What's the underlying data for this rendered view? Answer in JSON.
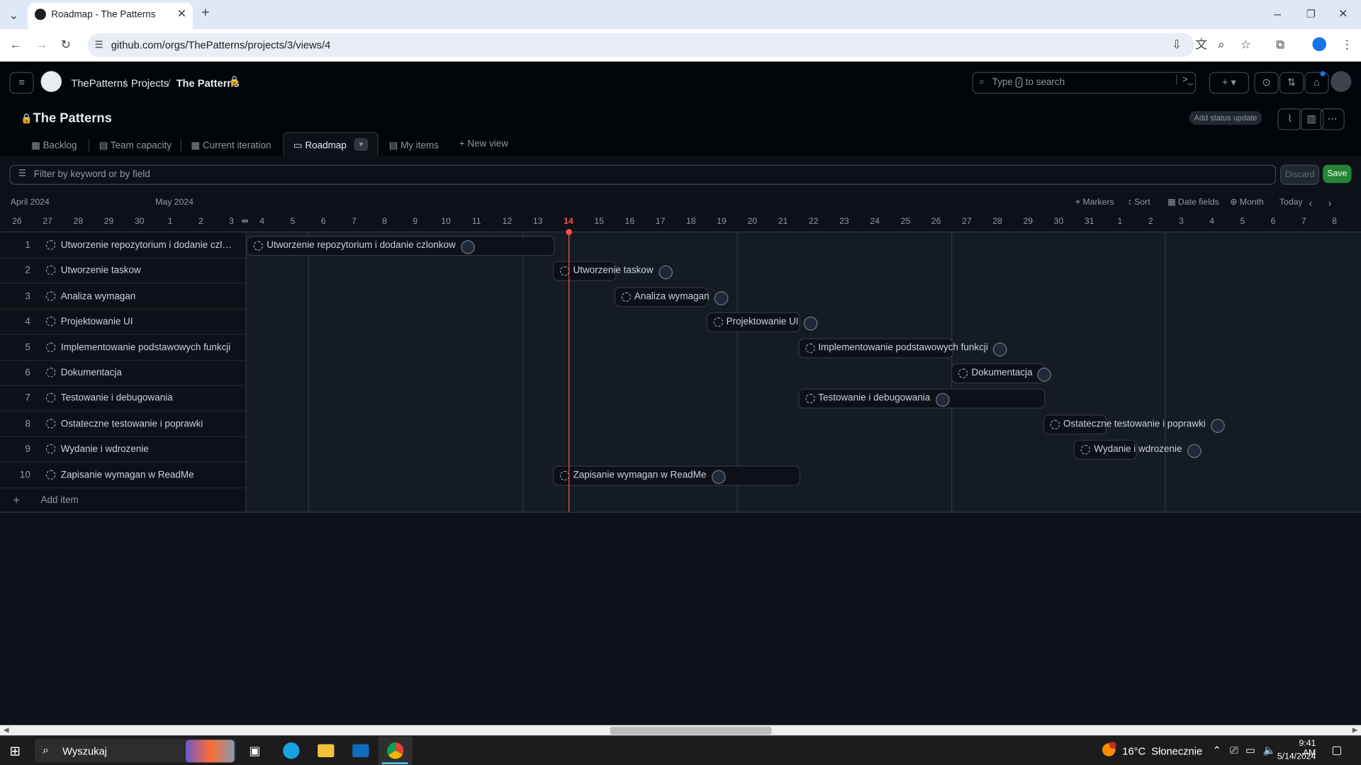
{
  "browser": {
    "tab_title": "Roadmap - The Patterns",
    "url": "github.com/orgs/ThePatterns/projects/3/views/4"
  },
  "header": {
    "breadcrumbs": [
      "ThePatterns",
      "Projects",
      "The Patterns"
    ],
    "search_placeholder_pre": "Type",
    "search_key": "/",
    "search_placeholder_post": "to search"
  },
  "project": {
    "title": "The Patterns",
    "status_button": "Add status update",
    "views": [
      "Backlog",
      "Team capacity",
      "Current iteration",
      "Roadmap",
      "My items"
    ],
    "new_view": "New view",
    "active_view": "Roadmap"
  },
  "filter": {
    "placeholder": "Filter by keyword or by field",
    "discard": "Discard",
    "save": "Save"
  },
  "timeline": {
    "months": [
      "April 2024",
      "May 2024"
    ],
    "days": [
      "26",
      "27",
      "28",
      "29",
      "30",
      "1",
      "2",
      "3",
      "4",
      "5",
      "6",
      "7",
      "8",
      "9",
      "10",
      "11",
      "12",
      "13",
      "14",
      "15",
      "16",
      "17",
      "18",
      "19",
      "20",
      "21",
      "22",
      "23",
      "24",
      "25",
      "26",
      "27",
      "28",
      "29",
      "30",
      "31",
      "1",
      "2",
      "3",
      "4",
      "5",
      "6",
      "7",
      "8"
    ],
    "today": "14",
    "controls": {
      "markers": "Markers",
      "sort": "Sort",
      "date_fields": "Date fields",
      "zoom": "Month",
      "today": "Today"
    }
  },
  "items": [
    {
      "num": "1",
      "title": "Utworzenie repozytorium i dodanie czlonk...",
      "bar_title": "Utworzenie repozytorium i dodanie czlonkow",
      "start": "2024-05-04",
      "end": "2024-05-13"
    },
    {
      "num": "2",
      "title": "Utworzenie taskow",
      "bar_title": "Utworzenie taskow",
      "start": "2024-05-14",
      "end": "2024-05-15"
    },
    {
      "num": "3",
      "title": "Analiza wymagan",
      "bar_title": "Analiza wymagan",
      "start": "2024-05-16",
      "end": "2024-05-18"
    },
    {
      "num": "4",
      "title": "Projektowanie UI",
      "bar_title": "Projektowanie UI",
      "start": "2024-05-19",
      "end": "2024-05-21"
    },
    {
      "num": "5",
      "title": "Implementowanie podstawowych funkcji",
      "bar_title": "Implementowanie podstawowych funkcji",
      "start": "2024-05-22",
      "end": "2024-05-26"
    },
    {
      "num": "6",
      "title": "Dokumentacja",
      "bar_title": "Dokumentacja",
      "start": "2024-05-27",
      "end": "2024-05-29"
    },
    {
      "num": "7",
      "title": "Testowanie i debugowania",
      "bar_title": "Testowanie i debugowania",
      "start": "2024-05-22",
      "end": "2024-05-29"
    },
    {
      "num": "8",
      "title": "Ostateczne testowanie i poprawki",
      "bar_title": "Ostateczne testowanie i poprawki",
      "start": "2024-05-30",
      "end": "2024-05-31"
    },
    {
      "num": "9",
      "title": "Wydanie i wdrozenie",
      "bar_title": "Wydanie i wdrozenie",
      "start": "2024-05-31",
      "end": "2024-06-01"
    },
    {
      "num": "10",
      "title": "Zapisanie wymagan w ReadMe",
      "bar_title": "Zapisanie wymagan w ReadMe",
      "start": "2024-05-14",
      "end": "2024-05-21"
    }
  ],
  "add_item": "Add item",
  "taskbar": {
    "search": "Wyszukaj",
    "weather": "16°C  Słonecznie",
    "time": "9:41 AM",
    "date": "5/14/2024"
  },
  "colors": {
    "today_marker": "#f85149",
    "save": "#238636",
    "bg": "#0d1117"
  }
}
